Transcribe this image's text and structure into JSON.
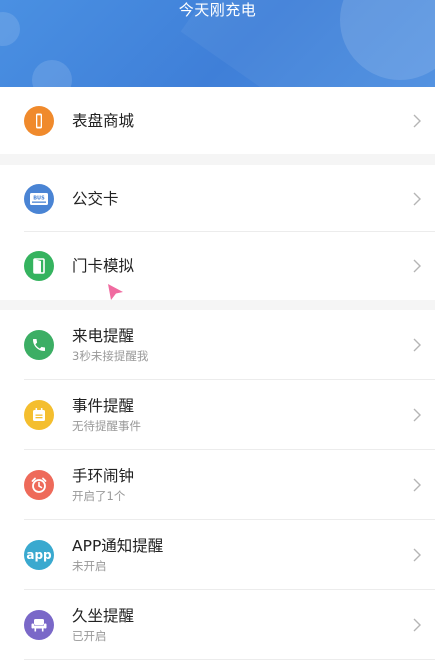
{
  "header": {
    "title": "今天刚充电"
  },
  "groups": [
    {
      "items": [
        {
          "id": "watch-face-store",
          "title": "表盘商城",
          "subtitle": "",
          "icon": "watch-icon",
          "color": "#f08a2c"
        }
      ]
    },
    {
      "items": [
        {
          "id": "bus-card",
          "title": "公交卡",
          "subtitle": "",
          "icon": "bus-card-icon",
          "color": "#4a84d4"
        },
        {
          "id": "door-card",
          "title": "门卡模拟",
          "subtitle": "",
          "icon": "door-icon",
          "color": "#35b35f"
        }
      ]
    },
    {
      "items": [
        {
          "id": "call-reminder",
          "title": "来电提醒",
          "subtitle": "3秒未接提醒我",
          "icon": "phone-icon",
          "color": "#3cae64"
        },
        {
          "id": "event-reminder",
          "title": "事件提醒",
          "subtitle": "无待提醒事件",
          "icon": "calendar-icon",
          "color": "#f4be2e"
        },
        {
          "id": "alarm-clock",
          "title": "手环闹钟",
          "subtitle": "开启了1个",
          "icon": "alarm-clock-icon",
          "color": "#ee6a5a"
        },
        {
          "id": "app-notify",
          "title": "APP通知提醒",
          "subtitle": "未开启",
          "icon": "app-icon",
          "color": "#3aa9cf"
        },
        {
          "id": "sedentary-reminder",
          "title": "久坐提醒",
          "subtitle": "已开启",
          "icon": "chair-icon",
          "color": "#7a68c8"
        }
      ]
    }
  ],
  "labels": {
    "bus_icon_text": "BUS",
    "app_icon_text": "app"
  }
}
